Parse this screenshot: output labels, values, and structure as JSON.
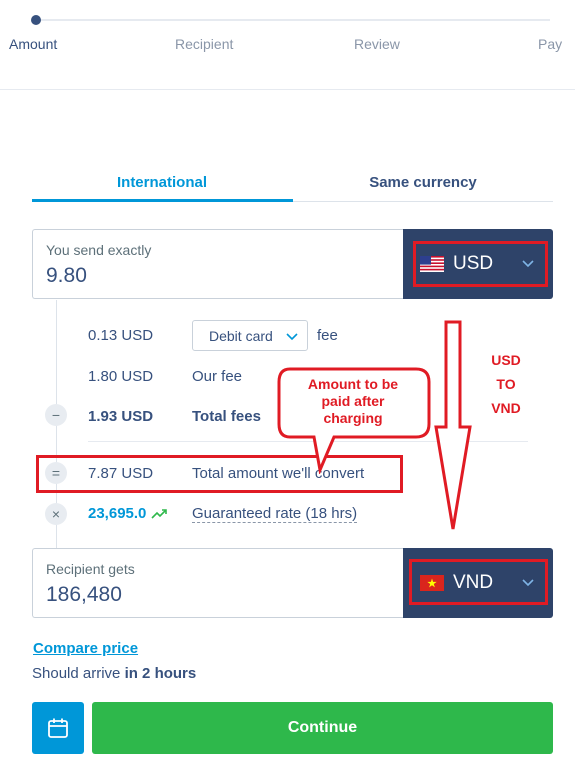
{
  "stepper": {
    "steps": [
      "Amount",
      "Recipient",
      "Review",
      "Pay"
    ]
  },
  "tabs": {
    "international": "International",
    "same_currency": "Same currency"
  },
  "send": {
    "label": "You send exactly",
    "value": "9.80",
    "currency": "USD",
    "flag": "us-flag"
  },
  "fees": {
    "card_fee_amount": "0.13 USD",
    "card_type": "Debit card",
    "card_fee_suffix": "fee",
    "our_fee_amount": "1.80 USD",
    "our_fee_label": "Our fee",
    "total_fees_amount": "1.93 USD",
    "total_fees_label": "Total fees",
    "convert_amount": "7.87 USD",
    "convert_label": "Total amount we'll convert",
    "rate": "23,695.0",
    "rate_label": "Guaranteed rate (18 hrs)",
    "minus_symbol": "−",
    "equals_symbol": "=",
    "times_symbol": "×"
  },
  "recipient": {
    "label": "Recipient gets",
    "value": "186,480",
    "currency": "VND",
    "flag": "vn-flag"
  },
  "footer": {
    "compare_link": "Compare price",
    "arrive_prefix": "Should arrive ",
    "arrive_time": "in 2 hours",
    "continue_label": "Continue"
  },
  "annotations": {
    "callout_line1": "Amount to be",
    "callout_line2": "paid after",
    "callout_line3": "charging",
    "conversion_line1": "USD",
    "conversion_line2": "TO",
    "conversion_line3": "VND",
    "color": "#e01b24"
  },
  "colors": {
    "accent": "#0097d8",
    "navy": "#37517e",
    "currency_bg": "#2e4369",
    "continue_bg": "#2eb84b"
  }
}
